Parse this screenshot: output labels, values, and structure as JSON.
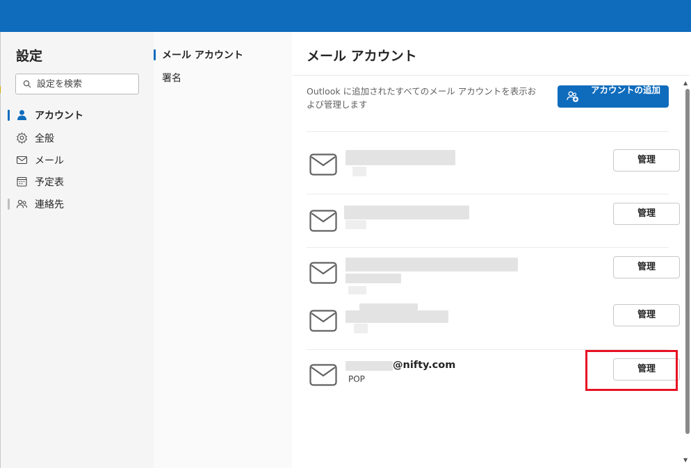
{
  "settings": {
    "title": "設定",
    "search_placeholder": "設定を検索"
  },
  "nav": {
    "items": [
      {
        "label": "アカウント",
        "icon": "person-icon",
        "active": true
      },
      {
        "label": "全般",
        "icon": "gear-icon"
      },
      {
        "label": "メール",
        "icon": "mail-icon"
      },
      {
        "label": "予定表",
        "icon": "calendar-icon"
      },
      {
        "label": "連絡先",
        "icon": "people-icon"
      }
    ]
  },
  "subnav": {
    "items": [
      {
        "label": "メール アカウント",
        "active": true
      },
      {
        "label": "署名"
      }
    ]
  },
  "main": {
    "title": "メール アカウント",
    "description": "Outlook に追加されたすべてのメール アカウントを表示および管理します",
    "add_button": "アカウントの追加",
    "accounts": [
      {
        "email": "",
        "type": "",
        "manage": "管理"
      },
      {
        "email": "",
        "type": "",
        "manage": "管理"
      },
      {
        "email": "",
        "type": "",
        "manage": "管理"
      },
      {
        "email": "",
        "type": "",
        "manage": "管理"
      },
      {
        "email": "@nifty.com",
        "type": "POP",
        "manage": "管理"
      }
    ]
  },
  "colors": {
    "accent": "#0f6cbd",
    "highlight": "#e81123"
  }
}
